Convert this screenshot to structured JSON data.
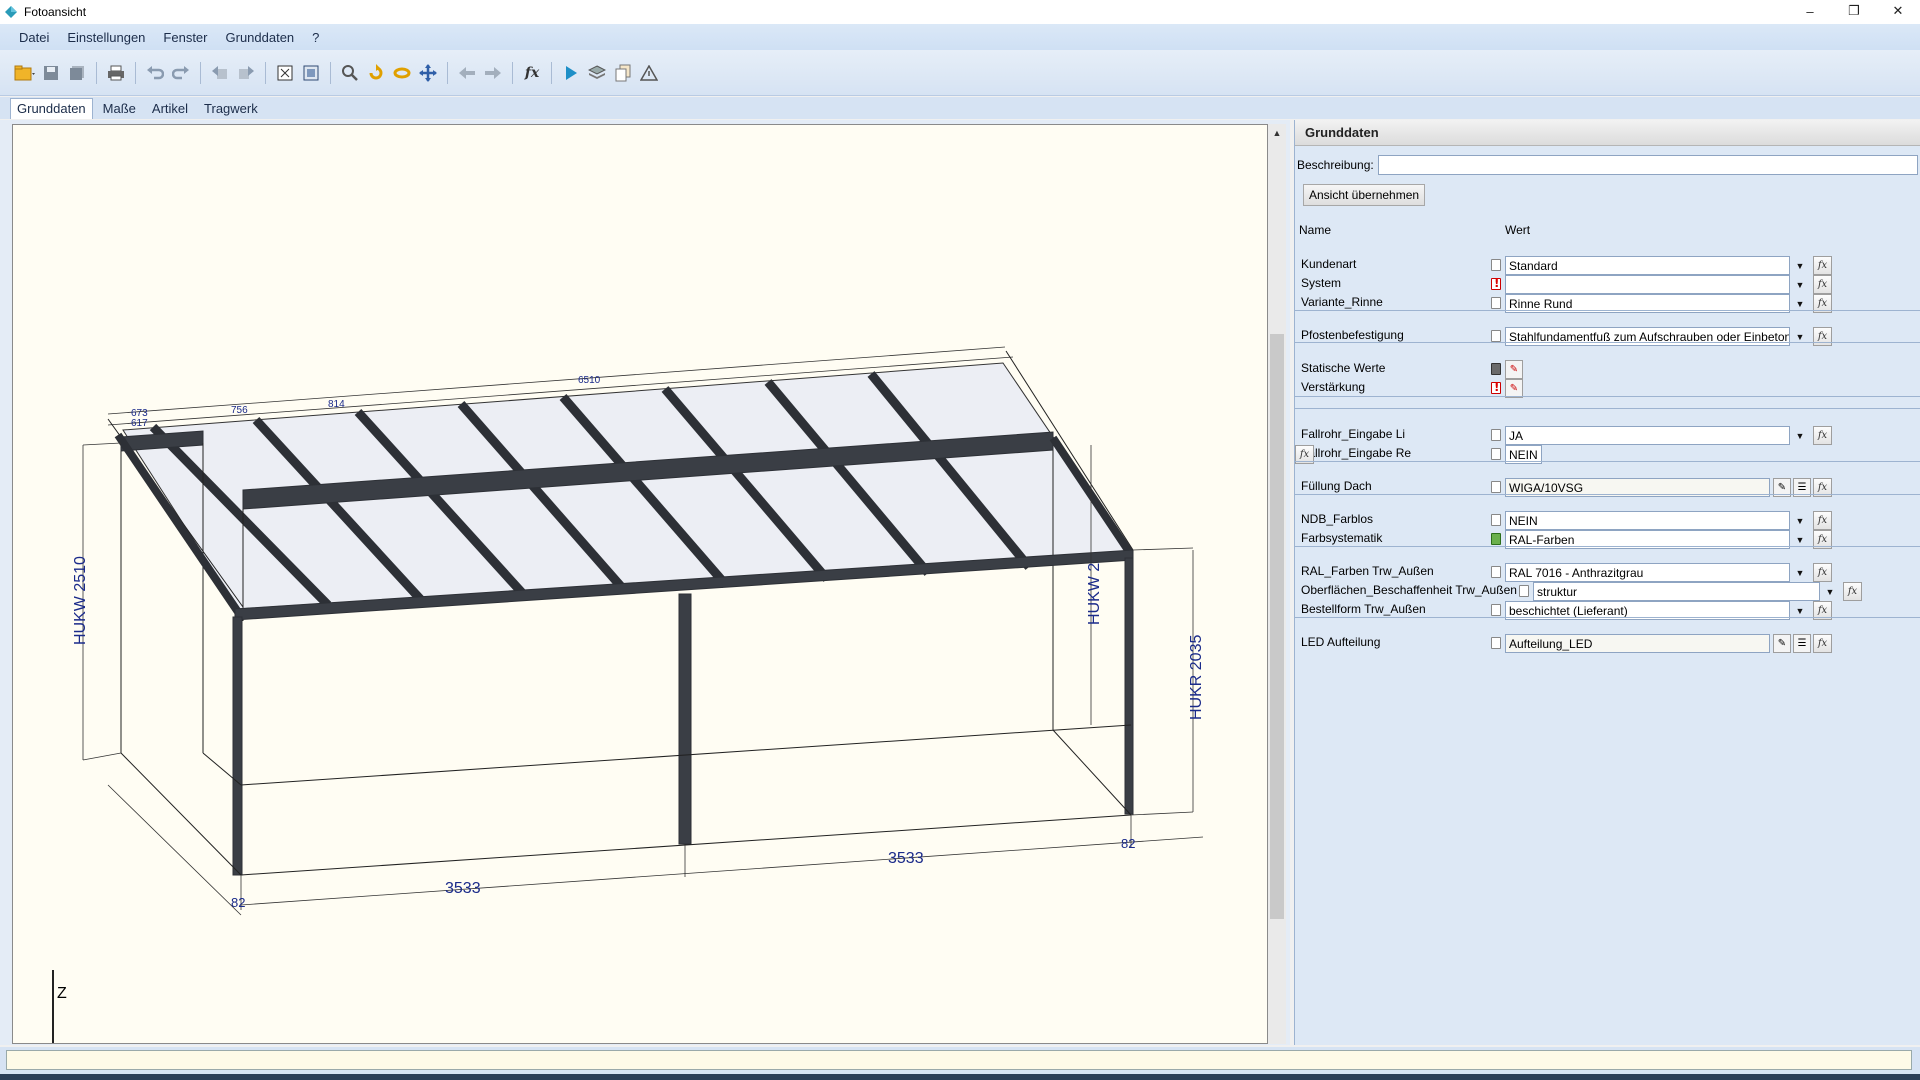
{
  "window": {
    "title": "Fotoansicht",
    "controls": [
      "–",
      "❐",
      "✕"
    ]
  },
  "menu": [
    "Datei",
    "Einstellungen",
    "Fenster",
    "Grunddaten",
    "?"
  ],
  "toolbar": [
    "folder-open-icon",
    "save-icon",
    "save-all-icon",
    "print-icon",
    "undo-icon",
    "redo-icon",
    "undo-step-icon",
    "redo-step-icon",
    "fit-view-icon",
    "view-icon",
    "zoom-icon",
    "rotate-icon",
    "orbit-icon",
    "pan-icon",
    "back-icon",
    "forward-icon",
    "formula-icon",
    "play-icon",
    "layers-icon",
    "copy-icon",
    "warning-icon"
  ],
  "tabs": [
    "Grunddaten",
    "Maße",
    "Artikel",
    "Tragwerk"
  ],
  "viewport": {
    "axis_label": "Z",
    "dimensions": {
      "hukw_left": "HUKW 2510",
      "hukw_right": "HUKW 2",
      "hukr": "HUKR 2035",
      "width_left": "3533",
      "width_right": "3533",
      "post_left": "82",
      "post_right": "82",
      "top_total": "6510",
      "top_a": "673",
      "top_b": "756",
      "top_c": "814",
      "top_d": "617"
    }
  },
  "panel": {
    "header": "Grunddaten",
    "description_label": "Beschreibung:",
    "description_value": "",
    "apply_button": "Ansicht übernehmen",
    "col_name": "Name",
    "col_value": "Wert",
    "fx_label": "fx",
    "rows": [
      {
        "name": "Kundenart",
        "value": "Standard"
      },
      {
        "name": "System",
        "value": ""
      },
      {
        "name": "Variante_Rinne",
        "value": "Rinne Rund"
      },
      {
        "name": "Pfostenbefestigung",
        "value": "Stahlfundamentfuß zum Aufschrauben oder Einbetonieren"
      },
      {
        "name": "Statische Werte",
        "value": ""
      },
      {
        "name": "Verstärkung",
        "value": ""
      },
      {
        "name": "Fallrohr_Eingabe Li",
        "value": "JA"
      },
      {
        "name": "Fallrohr_Eingabe Re",
        "value": "NEIN"
      },
      {
        "name": "Füllung Dach",
        "value": "WIGA/10VSG"
      },
      {
        "name": "NDB_Farblos",
        "value": "NEIN"
      },
      {
        "name": "Farbsystematik",
        "value": "RAL-Farben"
      },
      {
        "name": "RAL_Farben Trw_Außen",
        "value": "RAL 7016 - Anthrazitgrau"
      },
      {
        "name": "Oberflächen_Beschaffenheit Trw_Außen",
        "value": "struktur"
      },
      {
        "name": "Bestellform Trw_Außen",
        "value": "beschichtet (Lieferant)"
      },
      {
        "name": "LED Aufteilung",
        "value": "Aufteilung_LED"
      }
    ]
  }
}
